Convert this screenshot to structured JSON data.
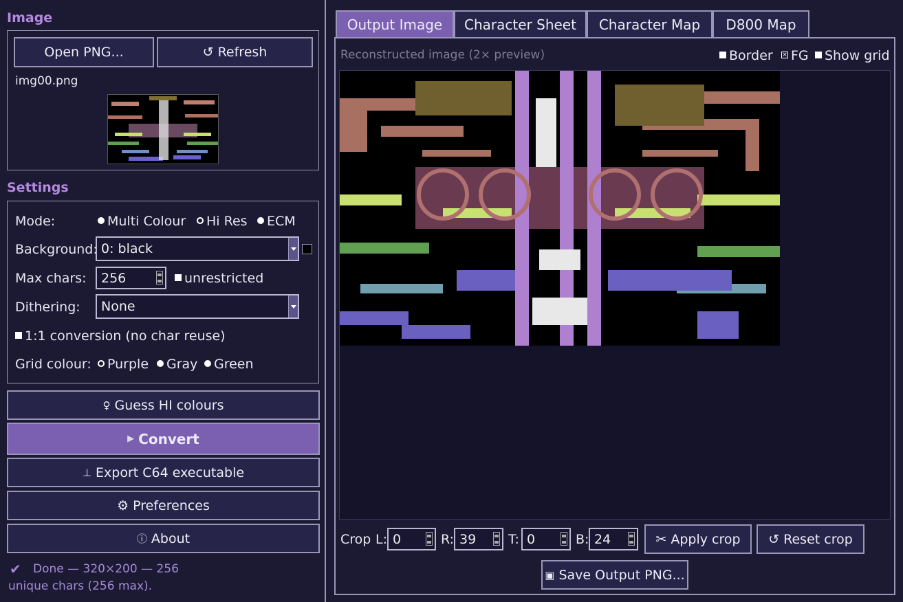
{
  "image_section": {
    "header": "Image",
    "open_label": "Open PNG...",
    "refresh_label": "Refresh",
    "filename": "img00.png"
  },
  "settings": {
    "header": "Settings",
    "mode_label": "Mode:",
    "modes": [
      "Multi Colour",
      "Hi Res",
      "ECM"
    ],
    "mode_selected": "Hi Res",
    "background_label": "Background:",
    "background_value": "0: black",
    "background_swatch": "#000000",
    "max_chars_label": "Max chars:",
    "max_chars_value": "256",
    "unrestricted_label": "unrestricted",
    "dithering_label": "Dithering:",
    "dithering_value": "None",
    "one_to_one_label": "1:1 conversion (no char reuse)",
    "grid_colour_label": "Grid colour:",
    "grid_colours": [
      "Purple",
      "Gray",
      "Green"
    ],
    "grid_colour_selected": "Purple"
  },
  "actions": {
    "guess": "Guess HI colours",
    "convert": "Convert",
    "export": "Export C64 executable",
    "preferences": "Preferences",
    "about": "About"
  },
  "status": {
    "line1": "Done — 320×200 — 256",
    "line2": "unique chars (256 max)."
  },
  "tabs": [
    "Output Image",
    "Character Sheet",
    "Character Map",
    "D800 Map"
  ],
  "active_tab": "Output Image",
  "output": {
    "caption": "Reconstructed image (2× preview)",
    "border_label": "Border",
    "fg_label": "FG",
    "show_grid_label": "Show grid",
    "crop_label": "Crop",
    "l_label": "L:",
    "l_value": "0",
    "r_label": "R:",
    "r_value": "39",
    "t_label": "T:",
    "t_value": "0",
    "b_label": "B:",
    "b_value": "24",
    "apply_crop": "Apply crop",
    "reset_crop": "Reset crop",
    "save_png": "Save Output PNG..."
  },
  "colors": {
    "accent": "#7b5fb0",
    "header": "#b48ae0",
    "status": "#a48ad8",
    "panel_bg": "#1c1a33",
    "button_bg": "#27244a"
  }
}
